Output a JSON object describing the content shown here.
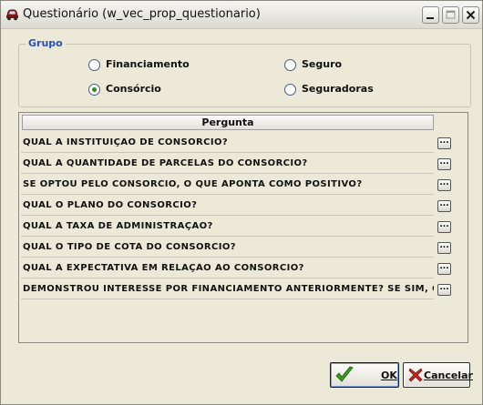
{
  "window": {
    "title": "Questionário  (w_vec_prop_questionario)"
  },
  "group": {
    "label": "Grupo",
    "options": [
      {
        "label": "Financiamento",
        "checked": false
      },
      {
        "label": "Seguro",
        "checked": false
      },
      {
        "label": "Consórcio",
        "checked": true
      },
      {
        "label": "Seguradoras",
        "checked": false
      }
    ]
  },
  "grid": {
    "header": "Pergunta",
    "button_label": "...",
    "rows": [
      "QUAL A INSTITUIÇÃO DE CONSÓRCIO?",
      "QUAL A QUANTIDADE DE PARCELAS DO CONSÓRCIO?",
      "SE OPTOU PELO CONSÓRCIO, O QUE APONTA COMO POSITIVO?",
      "QUAL O PLANO DO CONSÓRCIO?",
      "QUAL A TAXA DE ADMINISTRAÇÃO?",
      "QUAL O TIPO DE COTA DO CONSÓRCIO?",
      "QUAL A EXPECTATIVA EM RELAÇÃO AO CONSÓRCIO?",
      "DEMONSTROU INTERESSE POR FINANCIAMENTO ANTERIORMENTE? SE SIM, QUAL BANCO?"
    ]
  },
  "buttons": {
    "ok": "OK",
    "cancel": "Cancelar"
  },
  "colors": {
    "group_label": "#2b4ec1",
    "ok_icon": "#3a9a1e",
    "cancel_icon": "#c0281e"
  },
  "icons": {
    "app": "car-icon",
    "ok": "check-icon",
    "cancel": "x-icon"
  }
}
